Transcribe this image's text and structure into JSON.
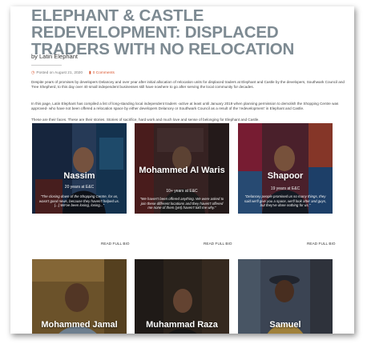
{
  "article": {
    "title": "ELEPHANT & CASTLE REDEVELOPMENT: DISPLACED TRADERS WITH NO RELOCATION",
    "byline": "by Latin Elephant",
    "posted": "Posted on August 21, 2020",
    "comments": "0 Comments",
    "paragraph1": "Despite years of promises by developers Delancey and over year after initial allocation of relocation units for displaced traders at Elephant and Castle by the developers, Southwark Council and Tree Shepherd, to this day over 40 small independent businesses still have nowhere to go after serving the local community for decades.",
    "paragraph2": "In this page, Latin Elephant has compiled a list of long-standing local independent traders -active at least until January 2019 when planning permission to demolish the Shopping Centre was approved- who have not been offered a relocation space by either developers Delancey or Southwark Council as a result of the 'redevelopment' in Elephant and Castle.",
    "paragraph3": "These are their faces. These are their stories. Stories of sacrifice, hard work and much love and sense of belonging for Elephant and Castle."
  },
  "read_label": "READ FULL BIO",
  "traders": [
    {
      "name": "Nassim",
      "years": "20 years at E&C",
      "quote": "\"The closing down of the Shopping Centre, for us, wasn't good news, because they haven't helped us. [...] We've been losing, losing...\""
    },
    {
      "name": "Mohammed Al Waris",
      "years": "10+ years at E&C",
      "quote": "\"We haven't been offered anything. We were asked to join these different locations and they haven't offered me none of them (yet) haven't told me why.\""
    },
    {
      "name": "Shapoor",
      "years": "19 years at E&C",
      "quote": "\"Delancey people promised us so many things, they said we'll give you a space, we'll look after and guys, but they've done nothing for us.\""
    },
    {
      "name": "Mohammed Jamal",
      "years": "",
      "quote": ""
    },
    {
      "name": "Muhammad Raza",
      "years": "",
      "quote": ""
    },
    {
      "name": "Samuel",
      "years": "",
      "quote": ""
    }
  ],
  "colors": {
    "title": "#7d8a92",
    "accent": "#d9532c"
  }
}
